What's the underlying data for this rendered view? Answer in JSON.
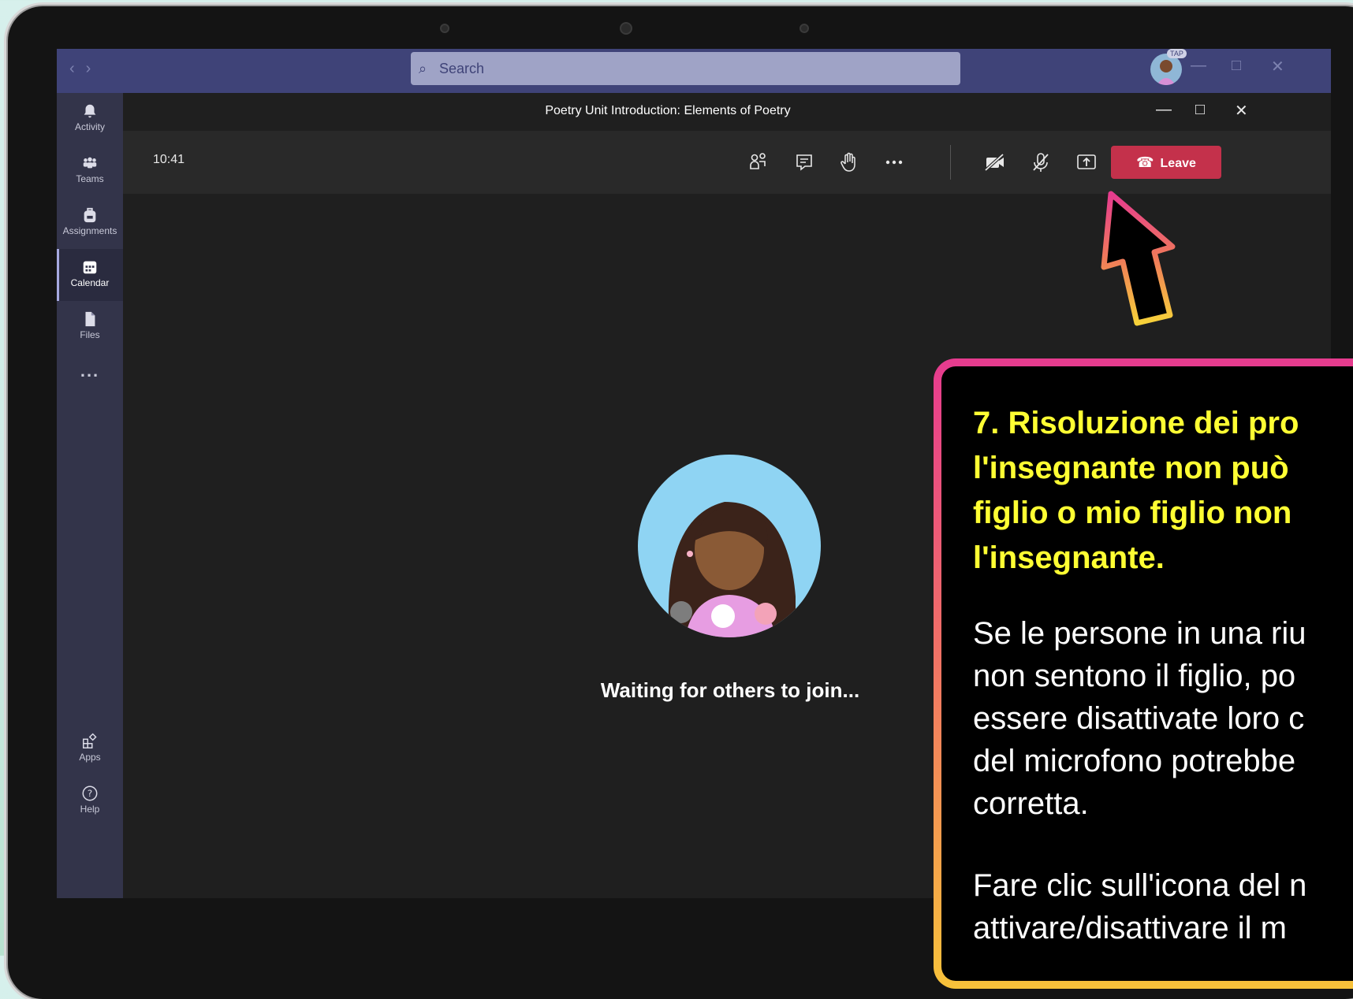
{
  "app": {
    "search_placeholder": "Search",
    "user_badge": "TAP"
  },
  "rail": {
    "items": [
      {
        "label": "Activity"
      },
      {
        "label": "Teams"
      },
      {
        "label": "Assignments"
      },
      {
        "label": "Calendar"
      },
      {
        "label": "Files"
      },
      {
        "label": "..."
      },
      {
        "label": "Apps"
      },
      {
        "label": "Help"
      }
    ]
  },
  "meeting": {
    "title": "Poetry Unit Introduction: Elements of Poetry",
    "time": "10:41",
    "leave_label": "Leave",
    "waiting_text": "Waiting for others to join..."
  },
  "colors": {
    "titlebar": "#3f4378",
    "rail": "#33344a",
    "leave": "#c4314b",
    "callout_title": "#ffff33"
  },
  "callout": {
    "title": "7. Risoluzione dei pro\nl'insegnante non può\nfiglio o mio figlio non\nl'insegnante.",
    "body": "Se le persone in una riu\nnon sentono il figlio, po\nessere disattivate loro c\ndel microfono potrebbe\ncorretta.",
    "body2": "Fare clic sull'icona del n\nattivare/disattivare il m"
  }
}
